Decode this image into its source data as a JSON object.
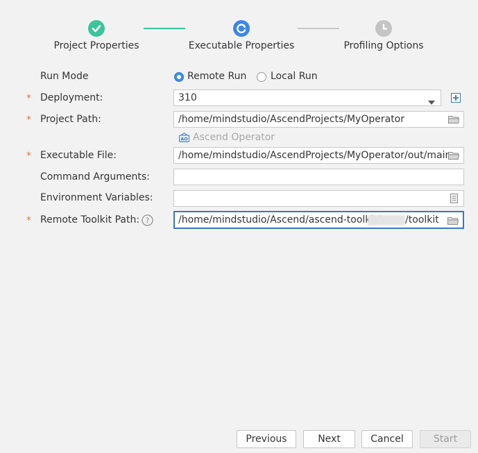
{
  "stepper": {
    "steps": [
      {
        "label": "Project Properties",
        "state": "done",
        "icon": "check-icon",
        "color": "#3cc49b"
      },
      {
        "label": "Executable Properties",
        "state": "current",
        "icon": "refresh-icon",
        "color": "#3c86e8"
      },
      {
        "label": "Profiling Options",
        "state": "pending",
        "icon": "clock-icon",
        "color": "#c4c4c4"
      }
    ],
    "connector_done_color": "#3cc49b",
    "connector_pending_color": "#c8c8c8"
  },
  "form": {
    "run_mode": {
      "label": "Run Mode",
      "options": [
        "Remote Run",
        "Local Run"
      ],
      "selected": "Remote Run"
    },
    "deployment": {
      "label": "Deployment:",
      "value": "310",
      "add_icon": "plus-icon"
    },
    "project_path": {
      "label": "Project Path:",
      "value": "/home/mindstudio/AscendProjects/MyOperator",
      "icon": "folder-icon"
    },
    "project_type": {
      "label": "Ascend Operator",
      "icon": "ascend-operator-icon"
    },
    "executable_file": {
      "label": "Executable File:",
      "value": "/home/mindstudio/AscendProjects/MyOperator/out/main",
      "icon": "folder-icon"
    },
    "command_arguments": {
      "label": "Command Arguments:",
      "value": ""
    },
    "environment_variables": {
      "label": "Environment Variables:",
      "value": "",
      "icon": "document-icon"
    },
    "remote_toolkit_path": {
      "label": "Remote Toolkit Path:",
      "value_prefix": "/home/mindstudio/Ascend/ascend-toolkit/",
      "value_suffix": "/toolkit",
      "help_icon": "question-icon",
      "icon": "folder-icon"
    },
    "required_marker": "*"
  },
  "buttons": {
    "previous": "Previous",
    "next": "Next",
    "cancel": "Cancel",
    "start": "Start"
  },
  "colors": {
    "accent": "#3a76bd",
    "required": "#e07a3d",
    "background": "#f2f2f2"
  }
}
